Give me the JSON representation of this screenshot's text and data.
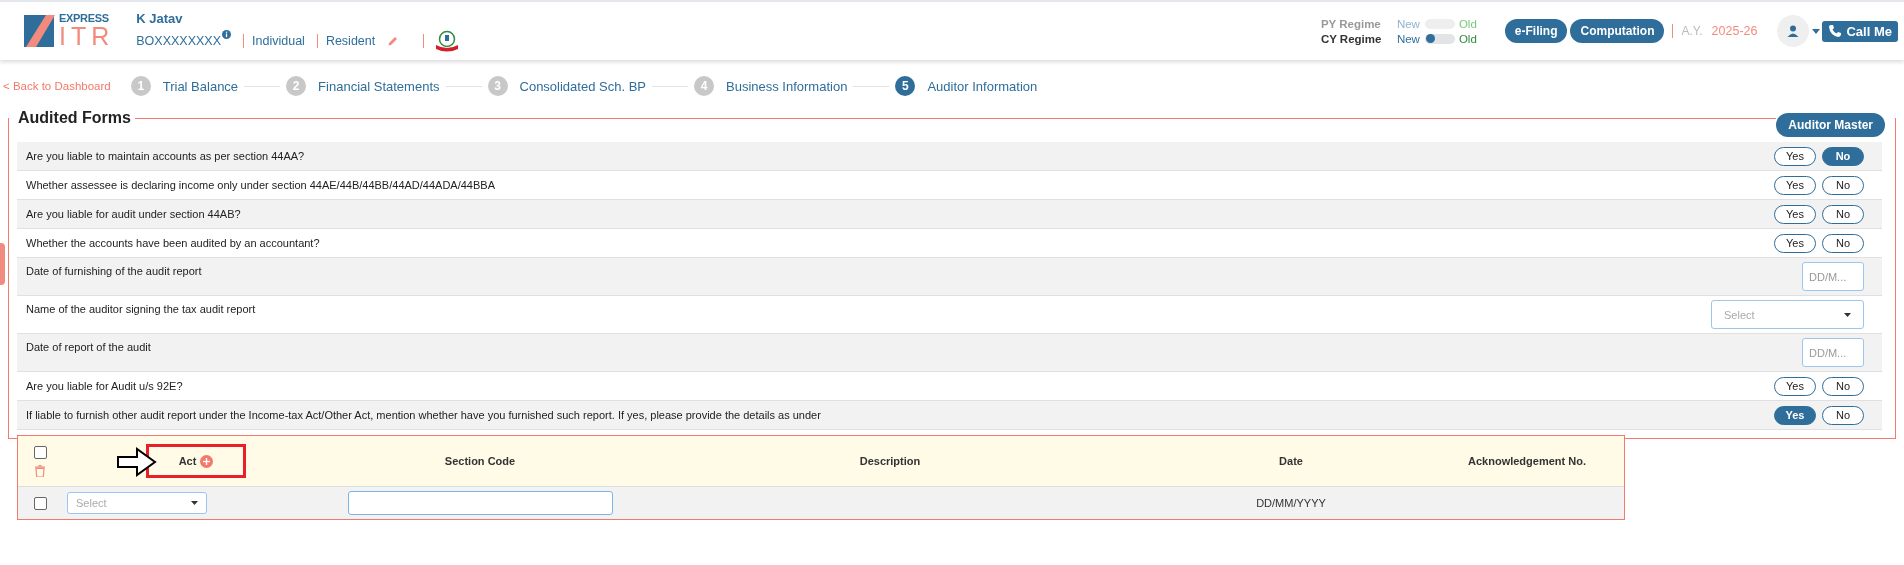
{
  "header": {
    "logo": {
      "top": "EXPRESS",
      "bottom": "ITR"
    },
    "user_name": "K Jatav",
    "pan": "BOXXXXXXXX",
    "status": "Individual",
    "residency": "Resident",
    "regimes": [
      {
        "label": "PY Regime",
        "left": "New",
        "right": "Old",
        "disabled": true
      },
      {
        "label": "CY Regime",
        "left": "New",
        "right": "Old",
        "disabled": false,
        "on": false
      }
    ],
    "buttons": [
      "e-Filing",
      "Computation"
    ],
    "ay_label": "A.Y.",
    "ay_value": "2025-26",
    "call_button": "Call Me"
  },
  "back_link": "< Back to Dashboard",
  "steps": [
    {
      "number": "1",
      "label": "Trial Balance",
      "selected": false
    },
    {
      "number": "2",
      "label": "Financial Statements",
      "selected": false
    },
    {
      "number": "3",
      "label": "Consolidated Sch. BP",
      "selected": false
    },
    {
      "number": "4",
      "label": "Business Information",
      "selected": false
    },
    {
      "number": "5",
      "label": "Auditor Information",
      "selected": true
    }
  ],
  "section": {
    "title": "Audited Forms",
    "master_button": "Auditor Master",
    "questions": [
      {
        "kind": "yesno",
        "text": "Are you liable to maintain accounts as per section 44AA?",
        "options": [
          {
            "label": "Yes",
            "selected": false
          },
          {
            "label": "No",
            "selected": true
          }
        ]
      },
      {
        "kind": "yesno",
        "text": "Whether assessee is declaring income only under section 44AE/44B/44BB/44AD/44ADA/44BBA",
        "options": [
          {
            "label": "Yes",
            "selected": false
          },
          {
            "label": "No",
            "selected": false
          }
        ]
      },
      {
        "kind": "yesno",
        "text": "Are you liable for audit under section 44AB?",
        "options": [
          {
            "label": "Yes",
            "selected": false
          },
          {
            "label": "No",
            "selected": false
          }
        ]
      },
      {
        "kind": "yesno",
        "text": "Whether the accounts have been audited by an accountant?",
        "options": [
          {
            "label": "Yes",
            "selected": false
          },
          {
            "label": "No",
            "selected": false
          }
        ]
      },
      {
        "kind": "date",
        "text": "Date of furnishing of the audit report",
        "placeholder": "DD/M..."
      },
      {
        "kind": "select",
        "text": "Name of the auditor signing the tax audit report",
        "placeholder": "Select"
      },
      {
        "kind": "date",
        "text": "Date of report of the audit",
        "placeholder": "DD/M..."
      },
      {
        "kind": "yesno",
        "text": "Are you liable for Audit u/s 92E?",
        "options": [
          {
            "label": "Yes",
            "selected": false
          },
          {
            "label": "No",
            "selected": false
          }
        ]
      },
      {
        "kind": "yesno",
        "text": "If liable to furnish other audit report under the Income-tax Act/Other Act, mention whether have you furnished such report. If yes, please provide the details as under",
        "options": [
          {
            "label": "Yes",
            "selected": true
          },
          {
            "label": "No",
            "selected": false
          }
        ]
      }
    ],
    "act_table": {
      "header_checked": false,
      "columns": [
        "Act",
        "Section Code",
        "Description",
        "Date",
        "Acknowledgement No."
      ],
      "rows": [
        {
          "checked": false,
          "act_placeholder": "Select",
          "date": "DD/MM/YYYY"
        }
      ]
    }
  }
}
